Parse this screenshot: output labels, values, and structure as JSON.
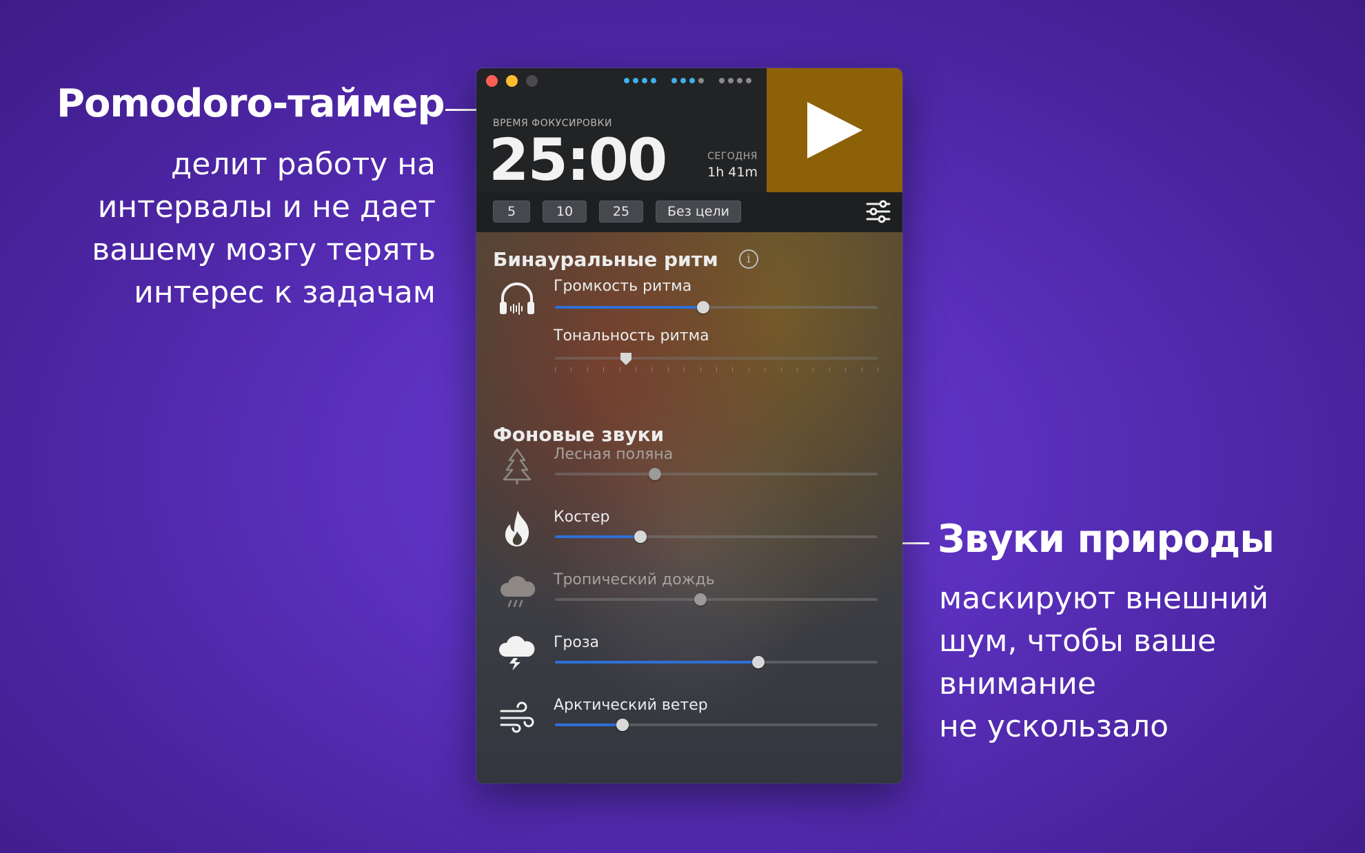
{
  "annotation_left": {
    "title": "Pomodoro-таймер",
    "lines": [
      "делит работу на",
      "интервалы и не дает",
      "вашему мозгу терять",
      "интерес к задачам"
    ]
  },
  "annotation_right": {
    "title": "Звуки природы",
    "lines": [
      "маскируют внешний",
      "шум, чтобы ваше",
      "внимание",
      "не ускользало"
    ]
  },
  "window": {
    "traffic_colors": [
      "#fc5f57",
      "#fdbc2e",
      "#4a4a4c"
    ],
    "session_dots": [
      {
        "colors": [
          "#3fb0ea",
          "#3fb0ea",
          "#3fb0ea",
          "#3fb0ea"
        ]
      },
      {
        "colors": [
          "#3fb0ea",
          "#3fb0ea",
          "#3fb0ea",
          "#8a8a8c"
        ]
      },
      {
        "colors": [
          "#8a8a8c",
          "#8a8a8c",
          "#8a8a8c",
          "#8a8a8c"
        ]
      }
    ],
    "focus_label": "ВРЕМЯ ФОКУСИРОВКИ",
    "timer": "25:00",
    "today_label": "СЕГОДНЯ",
    "today_value": "1h 41m",
    "play_icon": "play-icon",
    "accent_color": "#8d6108",
    "presets": [
      "5",
      "10",
      "25",
      "Без цели"
    ],
    "settings_icon": "sliders-icon"
  },
  "binaural": {
    "title": "Бинауральные ритм",
    "info_glyph": "i",
    "icon": "headphones-icon",
    "volume": {
      "label": "Громкость ритма",
      "value": 0.46
    },
    "tone": {
      "label": "Тональность ритма",
      "value": 0.22
    }
  },
  "background": {
    "title": "Фоновые звуки",
    "sounds": [
      {
        "label": "Лесная поляна",
        "icon": "tree-icon",
        "value": 0.31,
        "active": false
      },
      {
        "label": "Костер",
        "icon": "fire-icon",
        "value": 0.265,
        "active": true
      },
      {
        "label": "Тропический дождь",
        "icon": "rain-cloud-icon",
        "value": 0.45,
        "active": false
      },
      {
        "label": "Гроза",
        "icon": "thunderstorm-icon",
        "value": 0.63,
        "active": true
      },
      {
        "label": "Арктический ветер",
        "icon": "wind-icon",
        "value": 0.21,
        "active": true
      }
    ]
  }
}
